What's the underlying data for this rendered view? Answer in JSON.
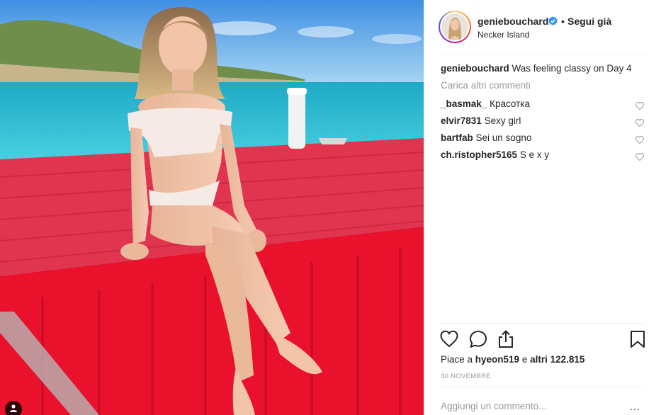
{
  "post": {
    "username": "geniebouchard",
    "follow_separator": "•",
    "follow_label": "Segui già",
    "location": "Necker Island",
    "caption_user": "geniebouchard",
    "caption_text": "Was feeling classy on Day 4",
    "load_more_label": "Carica altri commenti",
    "comments": [
      {
        "user": "_basmak_",
        "text": "Красотка"
      },
      {
        "user": "elvir7831",
        "text": "Sexy girl"
      },
      {
        "user": "bartfab",
        "text": "Sei un sogno"
      },
      {
        "user": "ch.ristopher5165",
        "text": "S e x y"
      }
    ],
    "likes": {
      "prefix": "Piace a ",
      "user": "hyeon519",
      "middle": " e ",
      "others": "altri 122.815"
    },
    "date": "30 NOVEMBRE",
    "add_comment_placeholder": "Aggiungi un commento...",
    "more_options": "..."
  },
  "icons": {
    "verified": "verified-badge-icon",
    "like": "heart-icon",
    "comment": "comment-bubble-icon",
    "share": "share-upload-icon",
    "save": "bookmark-icon",
    "user_tag": "user-tag-icon"
  },
  "colors": {
    "verified_blue": "#3897f0",
    "muted_text": "#999999",
    "text": "#262626",
    "divider": "#efefef"
  }
}
